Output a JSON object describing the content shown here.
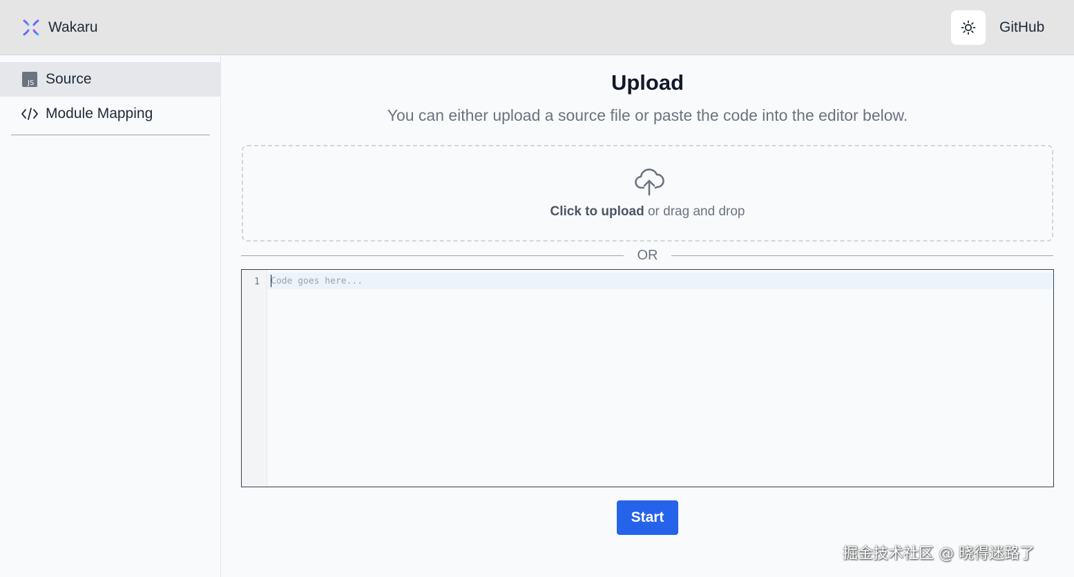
{
  "header": {
    "brand": "Wakaru",
    "github_label": "GitHub",
    "theme_icon": "sun-icon",
    "logo_icon": "wakaru-logo-icon",
    "accent": "#6366f1"
  },
  "sidebar": {
    "items": [
      {
        "label": "Source",
        "icon": "js-file-icon",
        "active": true
      },
      {
        "label": "Module Mapping",
        "icon": "code-icon",
        "active": false
      }
    ]
  },
  "main": {
    "title": "Upload",
    "subtitle": "You can either upload a source file or paste the code into the editor below.",
    "dropzone": {
      "icon": "cloud-upload-icon",
      "click_text": "Click to upload",
      "rest_text": " or drag and drop"
    },
    "or_label": "OR",
    "editor": {
      "line_number": "1",
      "placeholder": "Code goes here..."
    },
    "start_label": "Start",
    "start_color": "#2563eb"
  },
  "watermark": "掘金技术社区 @ 晓得迷路了"
}
